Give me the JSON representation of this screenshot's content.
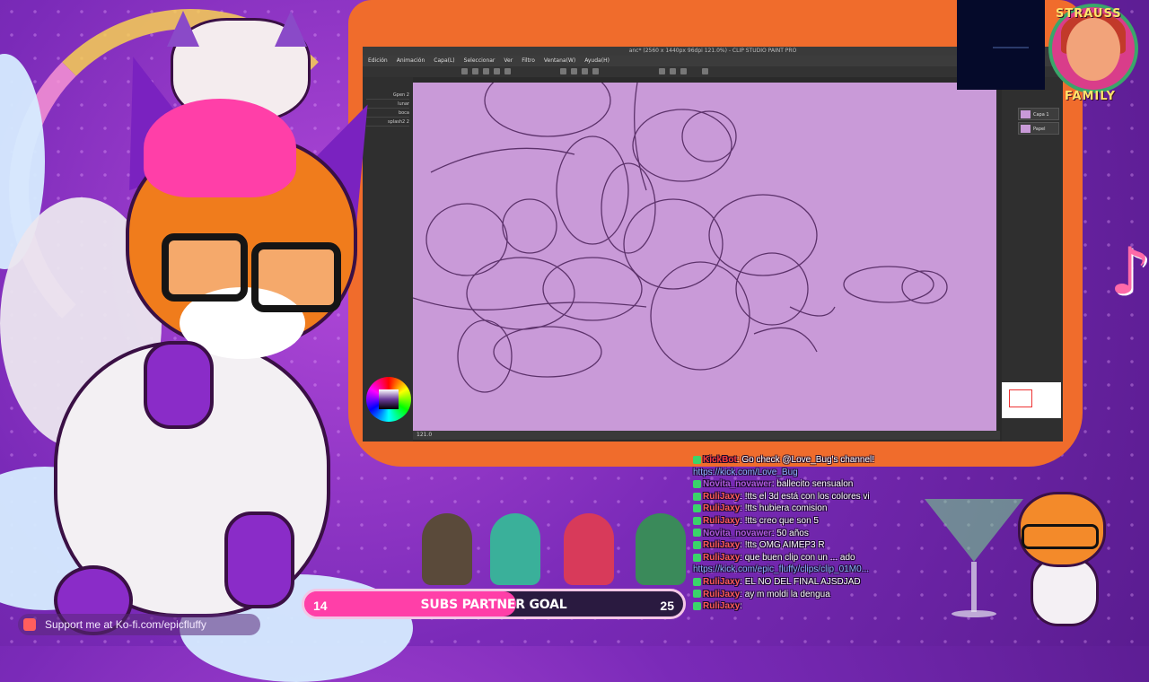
{
  "app": {
    "title": "anc* (2560 x 1440px 96dpi 121.0%) - CLIP STUDIO PAINT PRO",
    "menu": [
      "Edición",
      "Animación",
      "Capa(L)",
      "Seleccionar",
      "Ver",
      "Filtro",
      "Ventana(W)",
      "Ayuda(H)"
    ],
    "brushes": [
      "Gpen 2",
      "lunar",
      "boca",
      "splash2 2"
    ],
    "layers": [
      "Capa 1",
      "Papel"
    ],
    "status_zoom": "121.0"
  },
  "goal": {
    "label": "SUBS PARTNER GOAL",
    "current": "14",
    "target": "25",
    "fraction": 0.56
  },
  "kofi": {
    "text": "Support me at Ko-fi.com/epicfluffy"
  },
  "badge": {
    "top_word": "STRAUSS",
    "bottom_word": "FAMILY"
  },
  "chat": [
    {
      "user": "KickBot",
      "user_color": "#ff3a3a",
      "message": ": Go check @Love_Bug's channel!",
      "badge_color": "#3ad46a"
    },
    {
      "user": "",
      "user_color": "#8ab4ff",
      "message": "https://kick.com/Love_Bug",
      "link": true,
      "badge_color": ""
    },
    {
      "user": "Novita_novawer",
      "user_color": "#b05ae0",
      "message": ": ballecito sensualon",
      "badge_color": "#3ad46a"
    },
    {
      "user": "RuliJaxy",
      "user_color": "#ff5a5a",
      "message": ": !tts el 3d está con los colores vi",
      "badge_color": "#3ad46a"
    },
    {
      "user": "RuliJaxy",
      "user_color": "#ff5a5a",
      "message": ": !tts hubiera comision",
      "badge_color": "#3ad46a"
    },
    {
      "user": "RuliJaxy",
      "user_color": "#ff5a5a",
      "message": ": !tts creo que son 5",
      "badge_color": "#3ad46a"
    },
    {
      "user": "Novita_novawer",
      "user_color": "#b05ae0",
      "message": ": 50 años",
      "badge_color": "#3ad46a"
    },
    {
      "user": "RuliJaxy",
      "user_color": "#ff5a5a",
      "message": ": !tts OMG AIMEP3 R",
      "badge_color": "#3ad46a"
    },
    {
      "user": "RuliJaxy",
      "user_color": "#ff5a5a",
      "message": ": que buen clip con un ... ado",
      "badge_color": "#3ad46a"
    },
    {
      "user": "",
      "user_color": "#8ab4ff",
      "message": "https://kick.com/epic_fluffy/clips/clip_01M0...",
      "link": true,
      "badge_color": ""
    },
    {
      "user": "RuliJaxy",
      "user_color": "#ff5a5a",
      "message": ": EL NO DEL FINAL AJSDJAD",
      "badge_color": "#3ad46a"
    },
    {
      "user": "RuliJaxy",
      "user_color": "#ff5a5a",
      "message": ": ay m moldi la dengua",
      "badge_color": "#3ad46a"
    },
    {
      "user": "RuliJaxy",
      "user_color": "#ff5a5a",
      "message": ": ",
      "badge_color": "#3ad46a"
    }
  ],
  "colors": {
    "monitor_frame": "#f06c2c",
    "canvas": "#c99ad8",
    "goal_fill": "#ff3fa8",
    "background": "#7a2ab8"
  }
}
